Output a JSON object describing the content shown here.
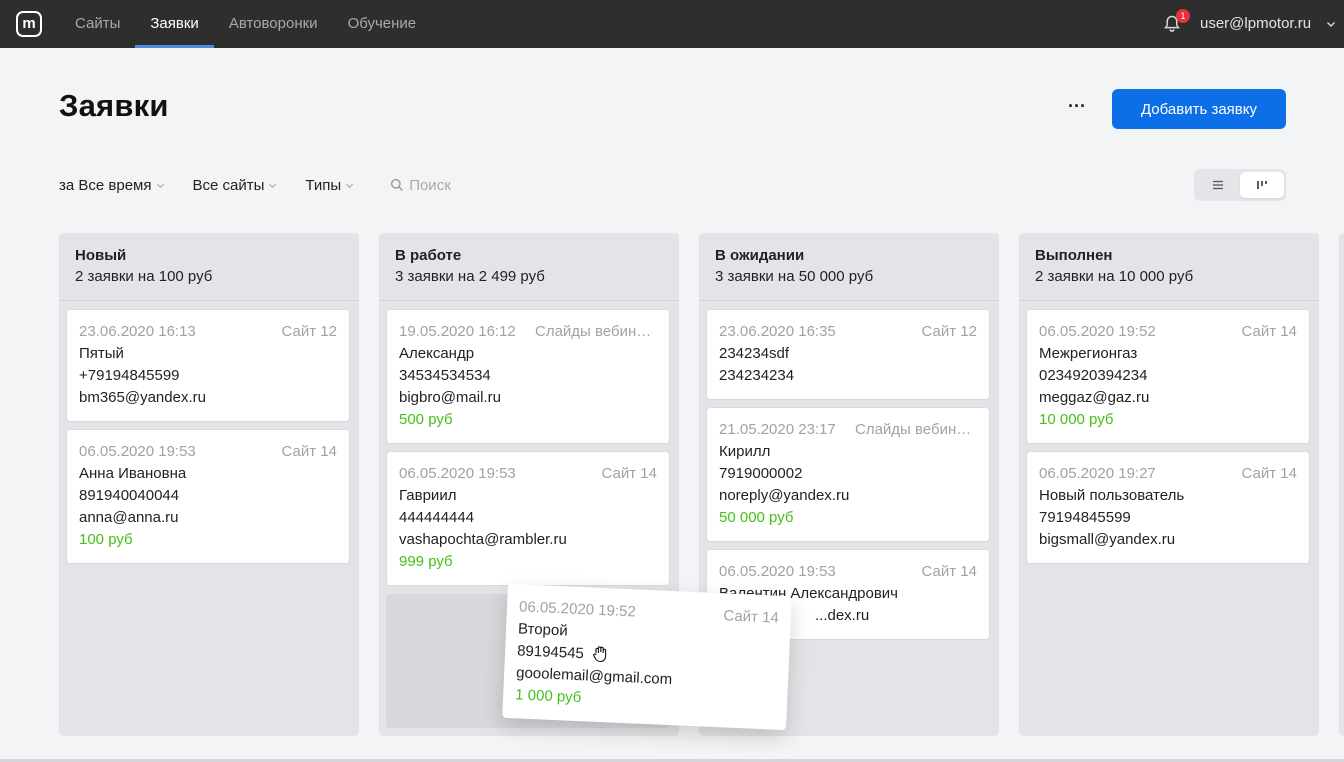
{
  "app": {
    "logo_letter": "m"
  },
  "nav": {
    "items": [
      {
        "label": "Сайты",
        "active": false
      },
      {
        "label": "Заявки",
        "active": true
      },
      {
        "label": "Автоворонки",
        "active": false
      },
      {
        "label": "Обучение",
        "active": false
      }
    ]
  },
  "header": {
    "notifications_count": "1",
    "user_email": "user@lpmotor.ru"
  },
  "page": {
    "title": "Заявки",
    "more_label": "···",
    "add_button": "Добавить заявку"
  },
  "filters": {
    "period": "за Все время",
    "sites": "Все сайты",
    "types": "Типы",
    "search_placeholder": "Поиск"
  },
  "colors": {
    "accent": "#0d6fe8",
    "price": "#46c01b",
    "topbar": "#2e2e2e",
    "badge": "#e5333a"
  },
  "columns": [
    {
      "title": "Новый",
      "summary": "2 заявки на 100 руб",
      "cards": [
        {
          "date": "23.06.2020 16:13",
          "site": "Сайт 12",
          "name": "Пятый",
          "phone": "+79194845599",
          "email": "bm365@yandex.ru",
          "price": ""
        },
        {
          "date": "06.05.2020 19:53",
          "site": "Сайт 14",
          "name": "Анна Ивановна",
          "phone": "891940040044",
          "email": "anna@anna.ru",
          "price": "100 руб"
        }
      ]
    },
    {
      "title": "В работе",
      "summary": "3 заявки на 2 499 руб",
      "cards": [
        {
          "date": "19.05.2020 16:12",
          "site": "Слайды вебинара",
          "name": "Александр",
          "phone": "34534534534",
          "email": "bigbro@mail.ru",
          "price": "500 руб"
        },
        {
          "date": "06.05.2020 19:53",
          "site": "Сайт 14",
          "name": "Гавриил",
          "phone": "444444444",
          "email": "vashapochta@rambler.ru",
          "price": "999 руб"
        }
      ]
    },
    {
      "title": "В ожидании",
      "summary": "3 заявки на 50 000 руб",
      "cards": [
        {
          "date": "23.06.2020 16:35",
          "site": "Сайт 12",
          "name": "234234sdf",
          "phone": "234234234",
          "email": "",
          "price": ""
        },
        {
          "date": "21.05.2020 23:17",
          "site": "Слайды вебинара",
          "name": "Кирилл",
          "phone": "7919000002",
          "email": "noreply@yandex.ru",
          "price": "50 000 руб"
        },
        {
          "date": "06.05.2020 19:53",
          "site": "Сайт 14",
          "name": "Валентин Александрович",
          "phone": "",
          "email": "...dex.ru",
          "price": ""
        }
      ]
    },
    {
      "title": "Выполнен",
      "summary": "2 заявки на 10 000 руб",
      "cards": [
        {
          "date": "06.05.2020 19:52",
          "site": "Сайт 14",
          "name": "Межрегионгаз",
          "phone": "0234920394234",
          "email": "meggaz@gaz.ru",
          "price": "10 000 руб"
        },
        {
          "date": "06.05.2020 19:27",
          "site": "Сайт 14",
          "name": "Новый пользователь",
          "phone": "79194845599",
          "email": "bigsmall@yandex.ru",
          "price": ""
        }
      ]
    }
  ],
  "dragging_card": {
    "date": "06.05.2020 19:52",
    "site": "Сайт 14",
    "name": "Второй",
    "phone": "89194545",
    "email": "gooolemail@gmail.com",
    "price": "1 000 руб"
  }
}
